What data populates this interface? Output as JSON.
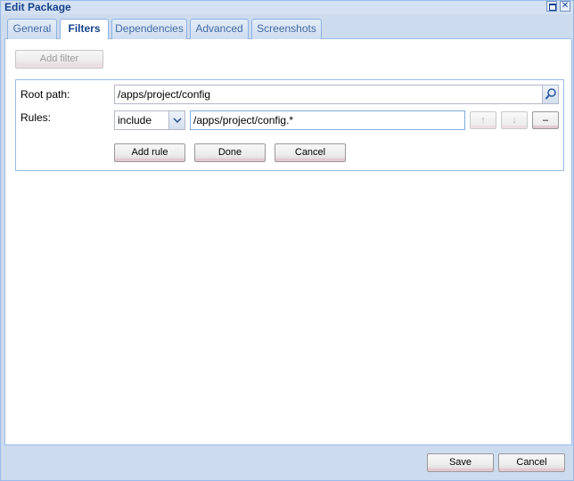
{
  "window": {
    "title": "Edit Package",
    "maximize_icon": "maximize-icon",
    "close_icon": "close-icon",
    "close_glyph": "✕"
  },
  "tabs": [
    {
      "label": "General"
    },
    {
      "label": "Filters"
    },
    {
      "label": "Dependencies"
    },
    {
      "label": "Advanced"
    },
    {
      "label": "Screenshots"
    }
  ],
  "active_tab": "Filters",
  "filters": {
    "add_filter_label": "Add filter",
    "root_path_label": "Root path:",
    "root_path_value": "/apps/project/config",
    "search_icon": "search-icon",
    "rules_label": "Rules:",
    "rule_mode_value": "include",
    "rule_pattern_value": "/apps/project/config.*",
    "move_up_label": "↑",
    "move_down_label": "↓",
    "remove_label": "–",
    "add_rule_label": "Add rule",
    "done_label": "Done",
    "cancel_label": "Cancel"
  },
  "footer": {
    "save_label": "Save",
    "cancel_label": "Cancel"
  },
  "colors": {
    "title_text": "#15428b",
    "border": "#99bbe8",
    "window_bg": "#cddbee"
  }
}
